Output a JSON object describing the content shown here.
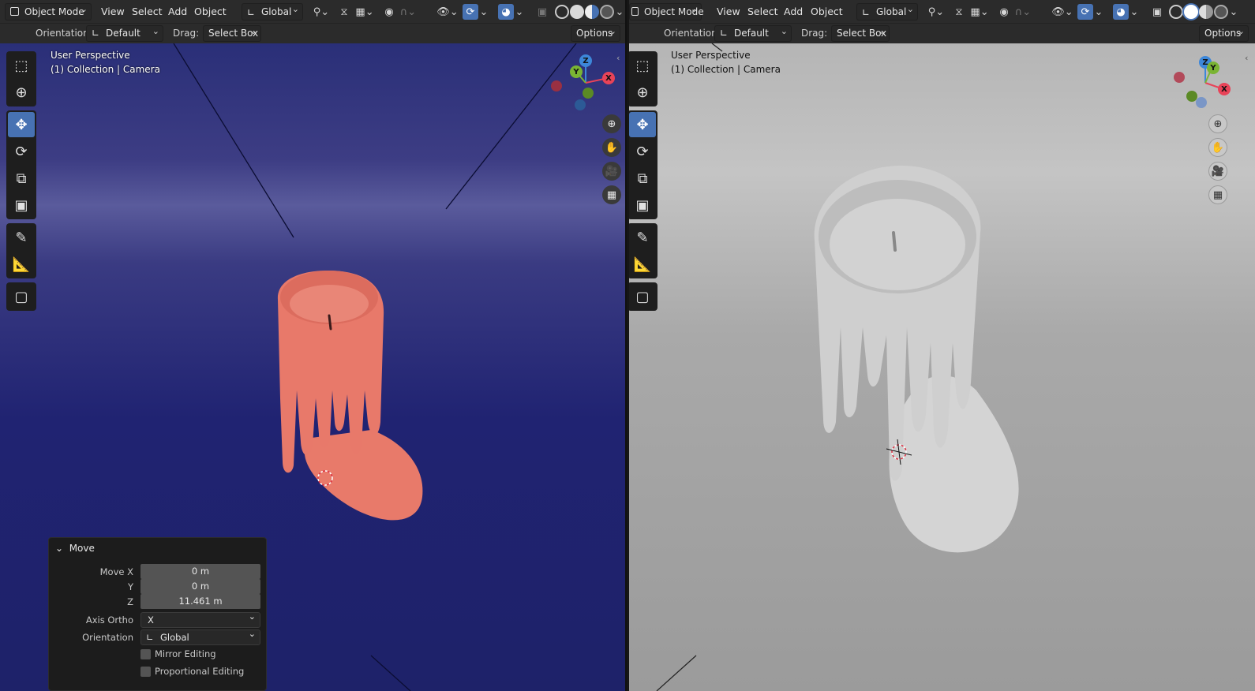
{
  "left": {
    "header": {
      "mode": "Object Mode",
      "menus": [
        "View",
        "Select",
        "Add",
        "Object"
      ],
      "transform_orientation": "Global",
      "orientation_label": "Orientation:",
      "orientation_value": "Default",
      "drag_label": "Drag:",
      "drag_value": "Select Box",
      "options_label": "Options"
    },
    "viewport": {
      "perspective": "User Perspective",
      "collection": "(1) Collection | Camera",
      "model_color": "#e8796a",
      "background_color": "#22256f"
    }
  },
  "right": {
    "header": {
      "mode": "Object Mode",
      "menus": [
        "View",
        "Select",
        "Add",
        "Object"
      ],
      "transform_orientation": "Global",
      "orientation_label": "Orientation:",
      "orientation_value": "Default",
      "drag_label": "Drag:",
      "drag_value": "Select Box",
      "options_label": "Options"
    },
    "viewport": {
      "perspective": "User Perspective",
      "collection": "(1) Collection | Camera",
      "model_color": "#cfcfcf",
      "background_color": "#b3b3b3"
    }
  },
  "gizmo": {
    "x": "X",
    "y": "Y",
    "z": "Z"
  },
  "redo_panel": {
    "title": "Move",
    "move_x_label": "Move X",
    "move_x": "0 m",
    "y_label": "Y",
    "y": "0 m",
    "z_label": "Z",
    "z": "11.461 m",
    "axis_ortho_label": "Axis Ortho",
    "axis_ortho": "X",
    "orientation_label": "Orientation",
    "orientation": "Global",
    "mirror_editing": "Mirror Editing",
    "proportional_editing": "Proportional Editing"
  },
  "colors": {
    "accent": "#4772b3",
    "header": "#2b2b2b",
    "axis_x": "#e84358",
    "axis_y": "#7ab433",
    "axis_z": "#3d87d9"
  }
}
